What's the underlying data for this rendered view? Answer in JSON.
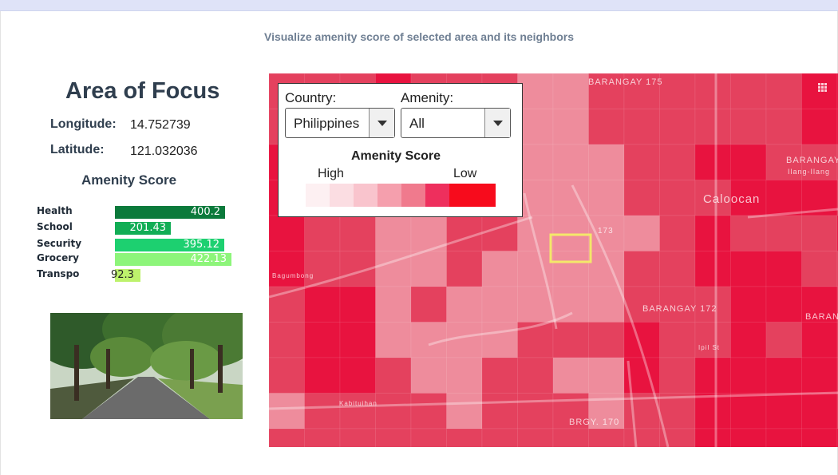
{
  "header": {
    "subtitle": "Visualize amenity score of selected area and its neighbors"
  },
  "focus": {
    "title": "Area of Focus",
    "longitude_label": "Longitude:",
    "longitude_value": "14.752739",
    "latitude_label": "Latitude:",
    "latitude_value": "121.032036",
    "score_title": "Amenity Score"
  },
  "chart_data": {
    "type": "bar",
    "categories": [
      "Health",
      "School",
      "Security",
      "Grocery",
      "Transpo"
    ],
    "values": [
      400.2,
      201.43,
      395.12,
      422.13,
      92.3
    ],
    "value_labels": [
      "400.2",
      "201.43",
      "395.12",
      "422.13",
      "92.3"
    ],
    "colors": [
      "#0b7a3b",
      "#12ad55",
      "#1dd070",
      "#8df57a",
      "#bdf26c"
    ]
  },
  "map": {
    "place_labels": [
      "BARANGAY 175",
      "Caloocan",
      "BARANGAY 172",
      "BRGY. 170",
      "BARANGAY",
      "Ilang-Ilang",
      "BARAN",
      "173",
      "Ipil St",
      "Kabituihan",
      "Bagumbong"
    ],
    "colors": {
      "base": "#e4415e",
      "light": "#ee8c9c",
      "strong": "#e8133f",
      "selection": "#f4e86a"
    }
  },
  "controls": {
    "country_label": "Country:",
    "country_value": "Philippines",
    "amenity_label": "Amenity:",
    "amenity_value": "All",
    "legend_title": "Amenity Score",
    "legend_high": "High",
    "legend_low": "Low",
    "legend_colors": [
      "#fdf0f2",
      "#fbdde2",
      "#f9c4cd",
      "#f59fad",
      "#f07a8d",
      "#ee2f5d",
      "#f70b1c"
    ]
  }
}
